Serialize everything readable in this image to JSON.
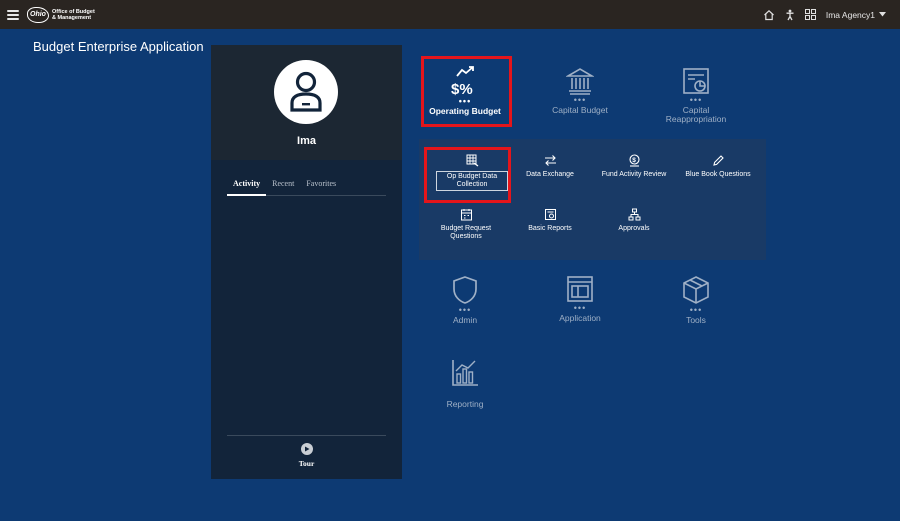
{
  "topbar": {
    "logo_mark": "Ohio",
    "logo_line1": "Office of Budget",
    "logo_line2": "& Management",
    "user_name": "Ima Agency1"
  },
  "app_title": "Budget Enterprise Application",
  "profile": {
    "name": "Ima",
    "tabs": [
      {
        "label": "Activity",
        "active": true
      },
      {
        "label": "Recent",
        "active": false
      },
      {
        "label": "Favorites",
        "active": false
      }
    ],
    "tour_label": "Tour"
  },
  "tiles": {
    "operating_budget": {
      "label": "Operating Budget",
      "dots": "•••",
      "active": true
    },
    "capital_budget": {
      "label": "Capital Budget",
      "dots": "•••"
    },
    "capital_reappropriation": {
      "label": "Capital Reappropriation",
      "dots": "•••"
    },
    "admin": {
      "label": "Admin",
      "dots": "•••"
    },
    "application": {
      "label": "Application",
      "dots": "•••"
    },
    "tools": {
      "label": "Tools",
      "dots": "•••"
    },
    "reporting": {
      "label": "Reporting"
    }
  },
  "submenu": {
    "op_budget_data_collection": "Op Budget Data Collection",
    "data_exchange": "Data Exchange",
    "fund_activity_review": "Fund Activity Review",
    "blue_book_questions": "Blue Book Questions",
    "budget_request_questions": "Budget Request Questions",
    "basic_reports": "Basic Reports",
    "approvals": "Approvals"
  },
  "colors": {
    "background": "#0d3a73",
    "topbar": "#2a2521",
    "panel": "#12243a",
    "submenu": "#193a66",
    "highlight": "#e4151b",
    "muted_text": "#9fb0c6"
  }
}
